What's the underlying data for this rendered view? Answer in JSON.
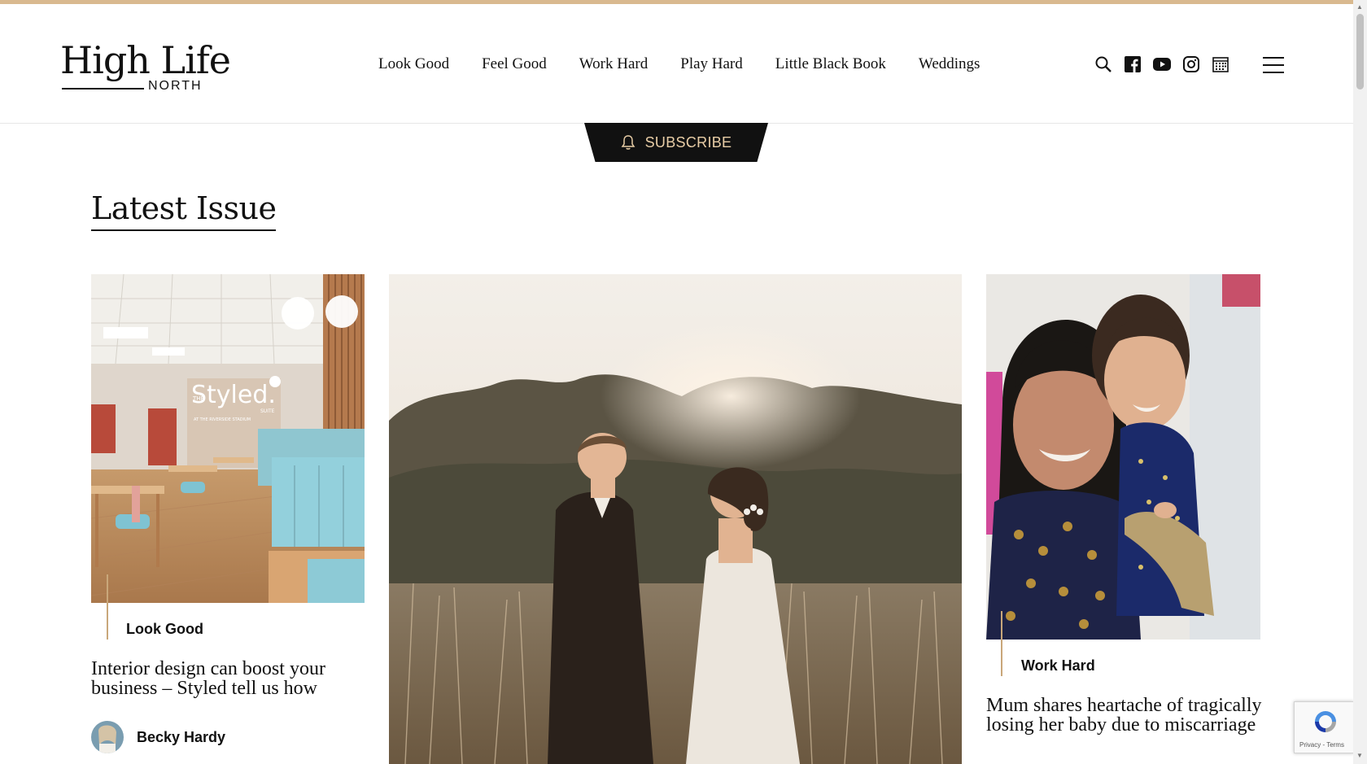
{
  "brand": {
    "name_main": "High Life",
    "name_sub": "NORTH"
  },
  "nav": {
    "items": [
      "Look Good",
      "Feel Good",
      "Work Hard",
      "Play Hard",
      "Little Black Book",
      "Weddings"
    ]
  },
  "header_icons": [
    "search-icon",
    "facebook-icon",
    "youtube-icon",
    "instagram-icon",
    "calendar-icon",
    "menu-icon"
  ],
  "subscribe": {
    "label": "SUBSCRIBE"
  },
  "section": {
    "title": "Latest Issue"
  },
  "cards": [
    {
      "category": "Look Good",
      "headline": "Interior design can boost your business – Styled tell us how",
      "author": "Becky Hardy",
      "image_sign_top": "THE",
      "image_sign_main": "Styled.",
      "image_sign_sub": "SUITE",
      "image_sign_small": "AT THE RIVERSIDE STADIUM"
    },
    {
      "category": "",
      "headline": ""
    },
    {
      "category": "Work Hard",
      "headline": "Mum shares heartache of tragically losing her baby due to miscarriage"
    }
  ],
  "recaptcha": {
    "text": "Privacy - Terms"
  },
  "colors": {
    "accent": "#d9b98f",
    "subscribe_text": "#e8cda6",
    "dark": "#111111"
  }
}
